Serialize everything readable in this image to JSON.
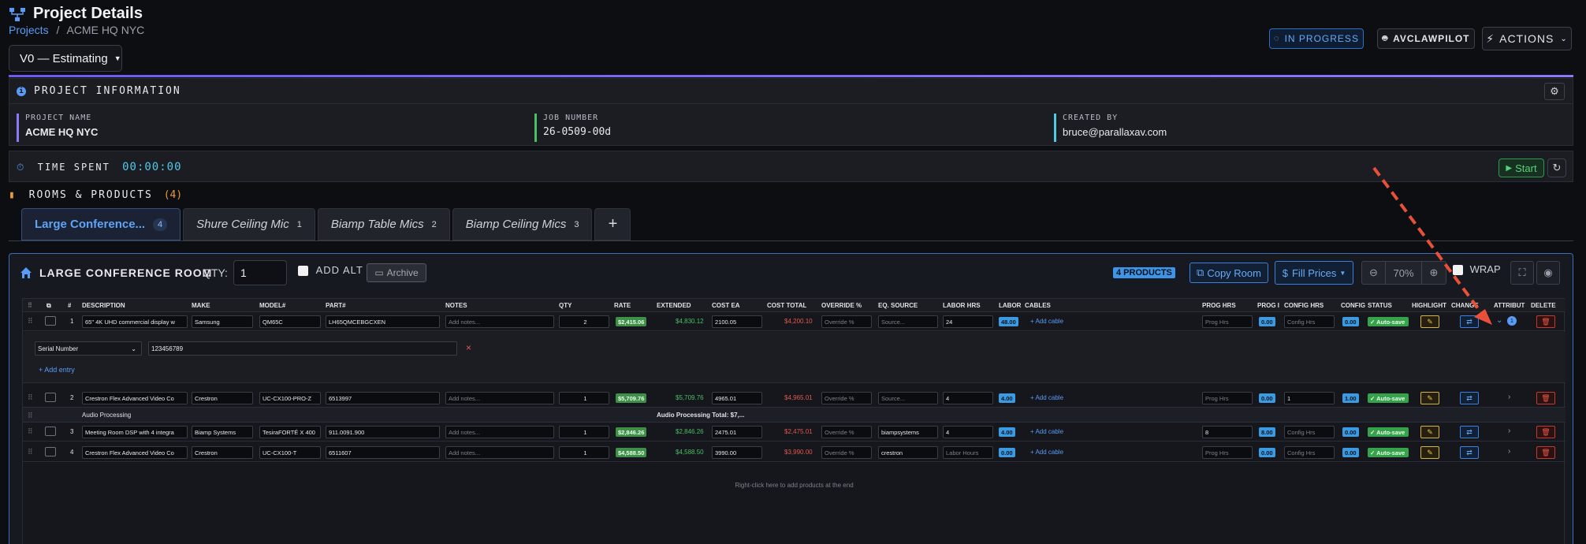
{
  "header": {
    "title": "Project Details",
    "breadcrumb_root": "Projects",
    "breadcrumb_sep": "/",
    "breadcrumb_current": "ACME HQ NYC",
    "version": "V0 — Estimating",
    "status": "IN PROGRESS",
    "pilot": "AVCLAWPILOT",
    "actions": "ACTIONS"
  },
  "project_info": {
    "heading": "PROJECT INFORMATION",
    "name_label": "PROJECT NAME",
    "name": "ACME HQ NYC",
    "job_label": "JOB NUMBER",
    "job": "26-0509-00d",
    "created_label": "CREATED BY",
    "created": "bruce@parallaxav.com"
  },
  "time": {
    "label": "TIME SPENT",
    "value": "00:00:00",
    "start": "Start"
  },
  "rooms": {
    "heading": "ROOMS & PRODUCTS",
    "count": "(4)",
    "tabs": [
      {
        "label": "Large Conference...",
        "count": "4"
      },
      {
        "label": "Shure Ceiling Mic",
        "count": "1"
      },
      {
        "label": "Biamp Table Mics",
        "count": "2"
      },
      {
        "label": "Biamp Ceiling Mics",
        "count": "3"
      }
    ],
    "add_tab": "+"
  },
  "room": {
    "title": "LARGE CONFERENCE ROOM",
    "qty_label": "QTY:",
    "qty": "1",
    "add_alt": "ADD ALT",
    "archive": "Archive",
    "products_badge": "4 PRODUCTS",
    "copy_room": "Copy Room",
    "fill_prices": "Fill Prices",
    "zoom": "70%",
    "wrap": "WRAP"
  },
  "columns": [
    "#",
    "DESCRIPTION",
    "MAKE",
    "MODEL#",
    "PART#",
    "NOTES",
    "QTY",
    "RATE",
    "EXTENDED",
    "COST EA",
    "COST TOTAL",
    "OVERRIDE %",
    "EQ. SOURCE",
    "LABOR HRS",
    "LABOR",
    "CABLES",
    "PROG HRS",
    "PROG I",
    "CONFIG HRS",
    "CONFIG",
    "STATUS",
    "HIGHLIGHT",
    "CHANGE",
    "ATTRIBUT",
    "DELETE"
  ],
  "rows": [
    {
      "num": "1",
      "desc": "65\" 4K UHD commercial display w",
      "make": "Samsung",
      "model": "QM65C",
      "part": "LH65QMCEBGCXEN",
      "notes": "Add notes...",
      "qty": "2",
      "rate": "$2,415.06",
      "extended": "$4,830.12",
      "cost_ea": "2100.05",
      "cost_total": "$4,200.10",
      "override": "Override %",
      "source": "Source...",
      "labor_hrs": "24",
      "labor": "48.00",
      "cable": "+ Add cable",
      "prog_hrs": "Prog Hrs",
      "prog": "0.00",
      "config_hrs": "Config Hrs",
      "config": "0.00",
      "status": "✓ Auto-save"
    },
    {
      "num": "2",
      "desc": "Crestron Flex Advanced Video Co",
      "make": "Crestron",
      "model": "UC-CX100-PRO-Z",
      "part": "6513997",
      "notes": "Add notes...",
      "qty": "1",
      "rate": "$5,709.76",
      "extended": "$5,709.76",
      "cost_ea": "4965.01",
      "cost_total": "$4,965.01",
      "override": "Override %",
      "source": "Source...",
      "labor_hrs": "4",
      "labor": "4.00",
      "cable": "+ Add cable",
      "prog_hrs": "Prog Hrs",
      "prog": "0.00",
      "config_hrs": "1",
      "config": "1.00",
      "status": "✓ Auto-save"
    },
    {
      "num": "3",
      "desc": "Meeting Room DSP with 4 integra",
      "make": "Biamp Systems",
      "model": "TesiraFORTÉ X 400",
      "part": "911.0091.900",
      "notes": "Add notes...",
      "qty": "1",
      "rate": "$2,846.26",
      "extended": "$2,846.26",
      "cost_ea": "2475.01",
      "cost_total": "$2,475.01",
      "override": "Override %",
      "source": "biampsystems",
      "labor_hrs": "4",
      "labor": "4.00",
      "cable": "+ Add cable",
      "prog_hrs": "8",
      "prog": "8.00",
      "config_hrs": "Config Hrs",
      "config": "0.00",
      "status": "✓ Auto-save"
    },
    {
      "num": "4",
      "desc": "Crestron Flex Advanced Video Co",
      "make": "Crestron",
      "model": "UC-CX100-T",
      "part": "6511607",
      "notes": "Add notes...",
      "qty": "1",
      "rate": "$4,588.50",
      "extended": "$4,588.50",
      "cost_ea": "3990.00",
      "cost_total": "$3,990.00",
      "override": "Override %",
      "source": "crestron",
      "labor_hrs": "Labor Hours",
      "labor": "0.00",
      "cable": "+ Add cable",
      "prog_hrs": "Prog Hrs",
      "prog": "0.00",
      "config_hrs": "Config Hrs",
      "config": "0.00",
      "status": "✓ Auto-save"
    }
  ],
  "attr": {
    "select": "Serial Number",
    "value": "123456789",
    "add_entry": "+ Add entry",
    "remove": "×",
    "count": "1"
  },
  "group": {
    "name": "Audio Processing",
    "total": "Audio Processing Total: $7,..."
  },
  "hint": "Right-click here to add products at the end",
  "colors": {
    "accent": "#5a9cf5",
    "green": "#4cbf64",
    "red": "#e2584d",
    "purple": "#6a5cf0",
    "orange": "#e89a3a"
  }
}
